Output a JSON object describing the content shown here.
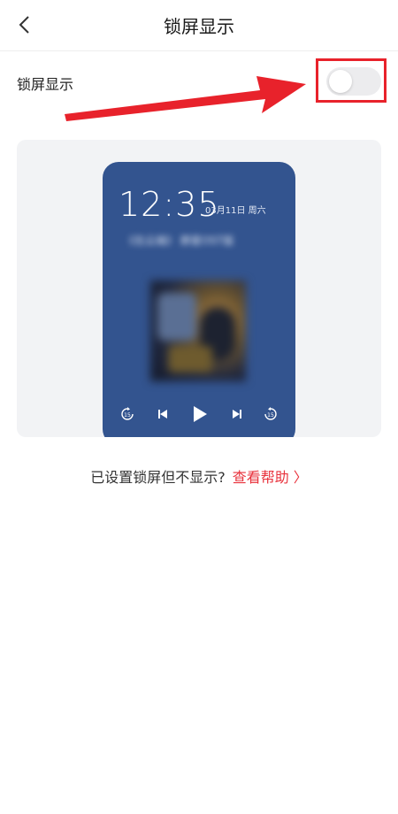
{
  "header": {
    "title": "锁屏显示",
    "back_icon": "chevron-left-icon"
  },
  "setting": {
    "label": "锁屏显示",
    "toggle_on": false
  },
  "annotation": {
    "color": "#e8222b"
  },
  "preview": {
    "time": "12:35",
    "date": "03月11日 周六",
    "song_text": "《在云端》 群星OST版",
    "accent": "#33548f"
  },
  "help": {
    "text": "已设置锁屏但不显示?",
    "link": "查看帮助 〉"
  }
}
